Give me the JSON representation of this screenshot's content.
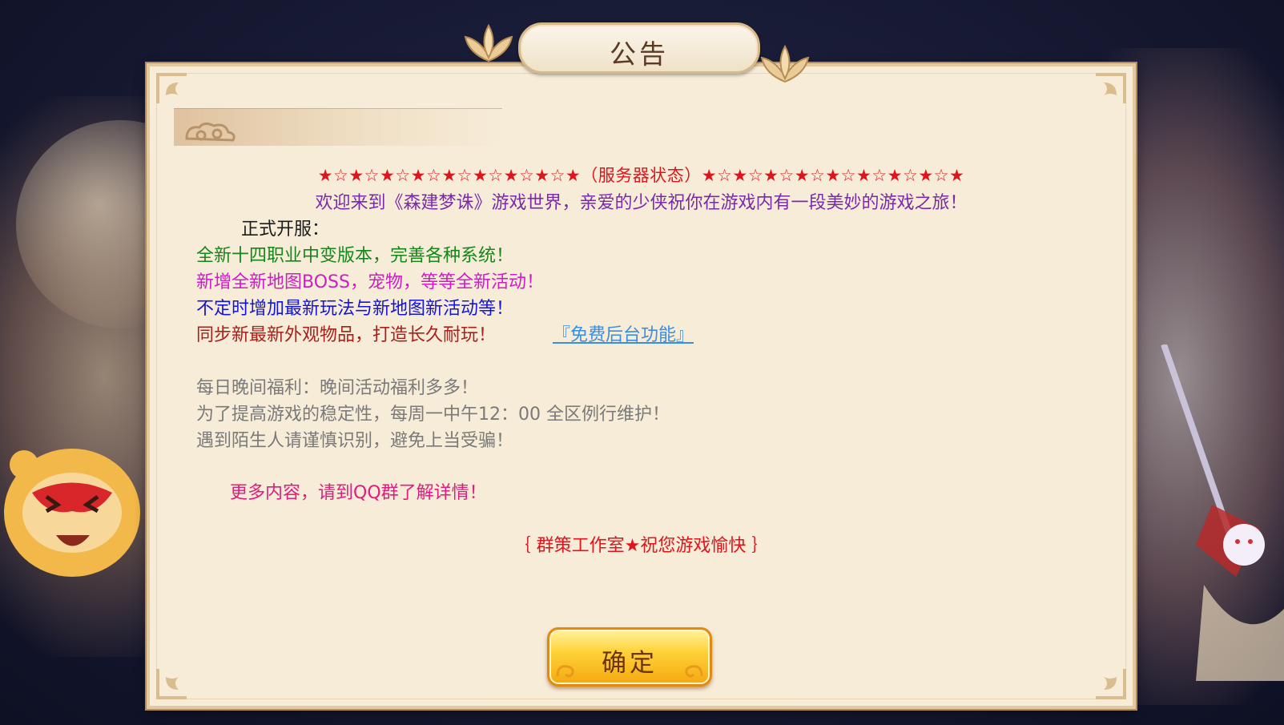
{
  "dialog": {
    "title": "公告",
    "lines": {
      "stars": "★☆★☆★☆★☆★☆★☆★☆★☆★（服务器状态）★☆★☆★☆★☆★☆★☆★☆★☆★",
      "welcome": "欢迎来到《森建梦诛》游戏世界，亲爱的少侠祝你在游戏内有一段美妙的游戏之旅！",
      "open": "正式开服：",
      "g1": "全新十四职业中变版本，完善各种系统！",
      "g2": "新增全新地图BOSS，宠物，等等全新活动！",
      "g3": "不定时增加最新玩法与新地图新活动等！",
      "g4": "同步新最新外观物品，打造长久耐玩！",
      "link": "『免费后台功能』",
      "gray1": "每日晚间福利：晚间活动福利多多！",
      "gray2": "为了提高游戏的稳定性，每周一中午12：00 全区例行维护！",
      "gray3": "遇到陌生人请谨慎识别，避免上当受骗！",
      "more": "更多内容，请到QQ群了解详情！",
      "studio": "｛ 群策工作室★祝您游戏愉快 ｝"
    },
    "confirm_label": "确定"
  },
  "colors": {
    "stars": "#e0141c",
    "welcome": "#7a2aa8",
    "green": "#16861a",
    "magenta": "#d01cc4",
    "blue": "#1414d8",
    "darkred": "#a8201c",
    "link": "#3a8ee0",
    "gray": "#7a7a7a",
    "pink": "#e01c80",
    "panel": "#f7ecd8",
    "button": "#ffd23a"
  }
}
